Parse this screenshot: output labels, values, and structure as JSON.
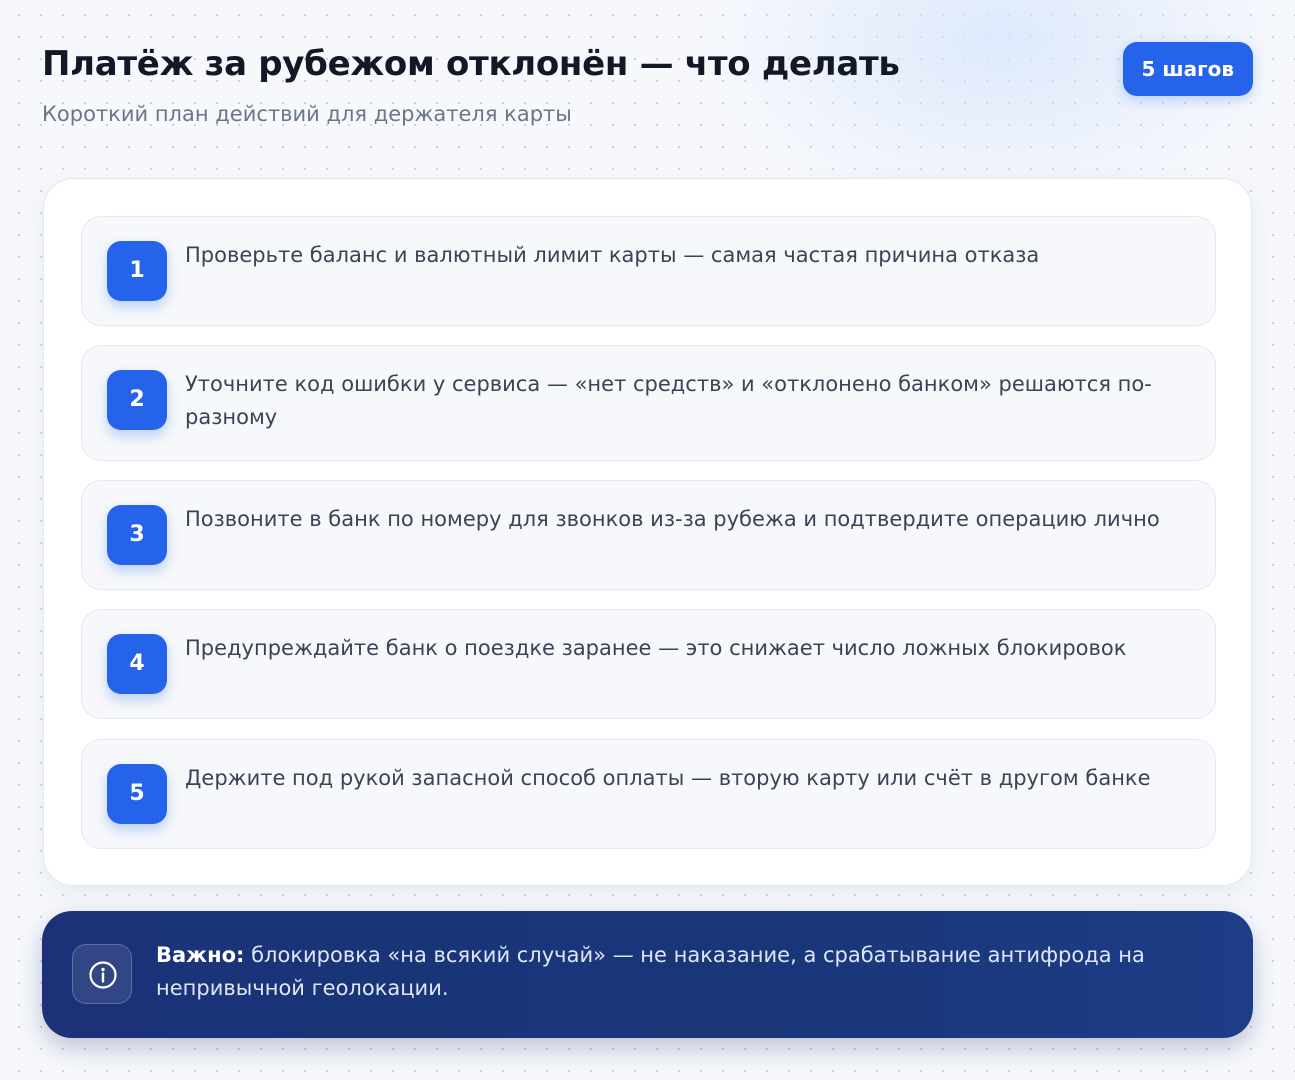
{
  "header": {
    "title": "Платёж за рубежом отклонён — что делать",
    "subtitle": "Короткий план действий для держателя карты",
    "badge": "5 шагов"
  },
  "steps": [
    {
      "number": "1",
      "text": "Проверьте баланс и валютный лимит карты — самая частая причина отказа"
    },
    {
      "number": "2",
      "text": "Уточните код ошибки у сервиса — «нет средств» и «отклонено банком» решаются по-разному"
    },
    {
      "number": "3",
      "text": "Позвоните в банк по номеру для звонков из-за рубежа и подтвердите операцию лично"
    },
    {
      "number": "4",
      "text": "Предупреждайте банк о поездке заранее — это снижает число ложных блокировок"
    },
    {
      "number": "5",
      "text": "Держите под рукой запасной способ оплаты — вторую карту или счёт в другом банке"
    }
  ],
  "note": {
    "icon": "info-icon",
    "lead": "Важно:",
    "text": " блокировка «на всякий случай» — не наказание, а срабатывание антифрода на непривычной геолокации."
  },
  "colors": {
    "accent": "#2563eb",
    "banner": "#1b3278",
    "title": "#121826",
    "muted": "#6a7689"
  }
}
